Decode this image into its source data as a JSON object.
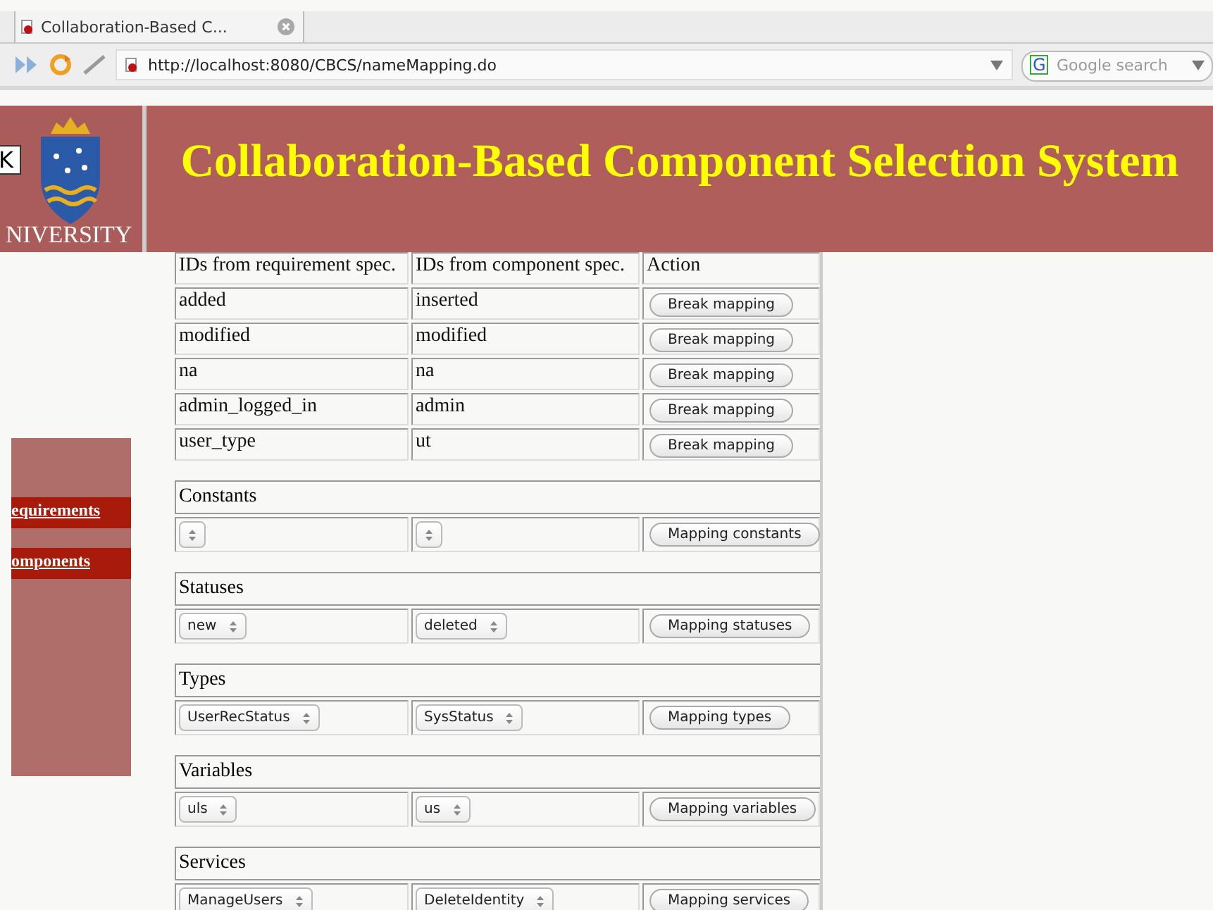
{
  "browser": {
    "tab": {
      "title": "Collaboration-Based C..."
    },
    "url": "http://localhost:8080/CBCS/nameMapping.do",
    "search": {
      "engine_label": "G",
      "placeholder": "Google search"
    }
  },
  "header": {
    "logo_sign": "K",
    "logo_text": "NIVERSITY",
    "title": "Collaboration-Based Component Selection System"
  },
  "sidebar": {
    "items": [
      {
        "label": "equirements"
      },
      {
        "label": "omponents"
      }
    ]
  },
  "mapping_table": {
    "columns": [
      "IDs from requirement spec.",
      "IDs from component spec.",
      "Action"
    ],
    "rows": [
      {
        "requirement_id": "added",
        "component_id": "inserted",
        "button": "Break mapping"
      },
      {
        "requirement_id": "modified",
        "component_id": "modified",
        "button": "Break mapping"
      },
      {
        "requirement_id": "na",
        "component_id": "na",
        "button": "Break mapping"
      },
      {
        "requirement_id": "admin_logged_in",
        "component_id": "admin",
        "button": "Break mapping"
      },
      {
        "requirement_id": "user_type",
        "component_id": "ut",
        "button": "Break mapping"
      }
    ]
  },
  "sections": [
    {
      "title": "Constants",
      "button": "Mapping constants"
    },
    {
      "title": "Statuses",
      "requirement_value": "new",
      "component_value": "deleted",
      "button": "Mapping statuses"
    },
    {
      "title": "Types",
      "requirement_value": "UserRecStatus",
      "component_value": "SysStatus",
      "button": "Mapping types"
    },
    {
      "title": "Variables",
      "requirement_value": "uls",
      "component_value": "us",
      "button": "Mapping variables"
    },
    {
      "title": "Services",
      "requirement_value": "ManageUsers",
      "component_value": "DeleteIdentity",
      "button": "Mapping services"
    }
  ]
}
